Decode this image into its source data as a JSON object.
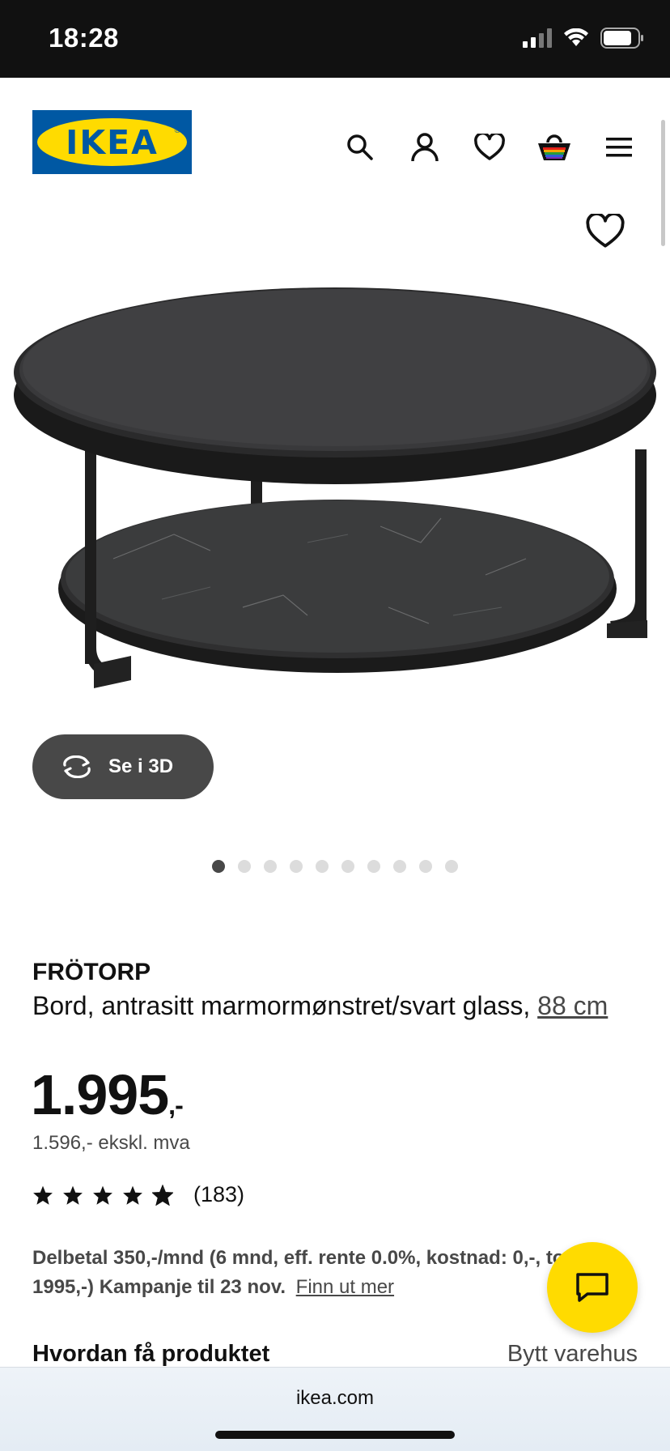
{
  "status": {
    "time": "18:28"
  },
  "header": {
    "logo_text": "IKEA",
    "icons": [
      "search-icon",
      "profile-icon",
      "heart-icon",
      "cart-icon",
      "menu-icon"
    ]
  },
  "product": {
    "btn_3d_label": "Se i 3D",
    "carousel": {
      "total": 10,
      "active_index": 0
    },
    "brand": "FRÖTORP",
    "description": "Bord, antrasitt marmormønstret/svart glass,",
    "dimension": "88 cm",
    "price_main": "1.995",
    "price_suffix": ",-",
    "price_ex_vat": "1.596,- ekskl. mva",
    "rating": {
      "stars": 4.5,
      "count": "(183)"
    },
    "delbetal_text": "Delbetal 350,-/mnd (6 mnd, eff. rente 0.0%, kostnad: 0,-, totalt 1995,-) Kampanje til 23 nov.",
    "delbetal_link": "Finn ut mer",
    "how_title": "Hvordan få produktet",
    "change_store": "Bytt varehus"
  },
  "browser": {
    "url": "ikea.com"
  },
  "colors": {
    "brand_blue": "#0058a3",
    "brand_yellow": "#ffdb00",
    "dark": "#111111"
  }
}
